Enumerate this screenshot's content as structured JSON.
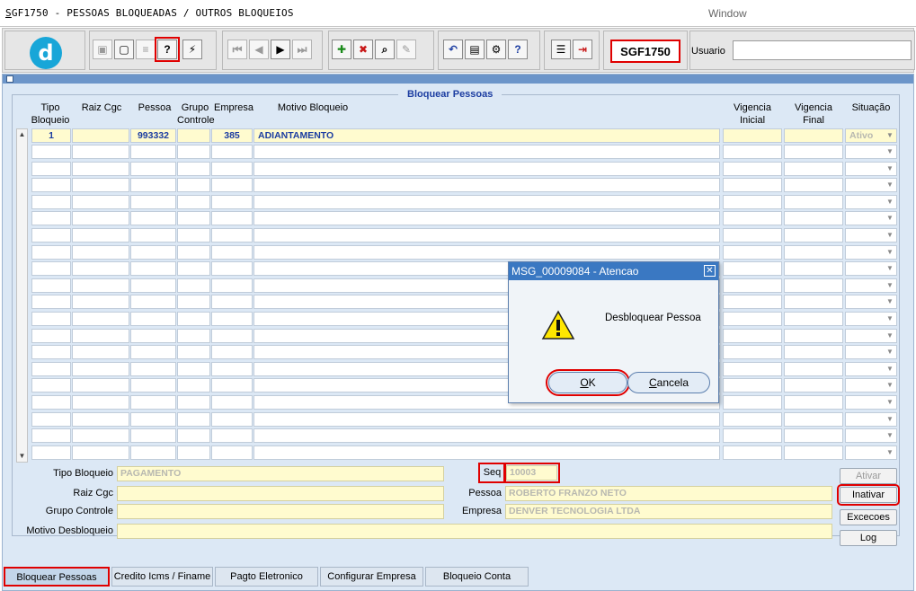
{
  "window": {
    "title_prefix": "S",
    "title_rest": "GF1750 - PESSOAS BLOQUEADAS / OUTROS BLOQUEIOS",
    "menu_window": "Window"
  },
  "toolbar": {
    "logo_letter": "d",
    "form_code": "SGF1750",
    "user_label": "Usuario",
    "user_value": "",
    "buttons": [
      {
        "icon": "save-icon",
        "glyph": "▣",
        "disabled": true
      },
      {
        "icon": "print-preview-icon",
        "glyph": "▢",
        "disabled": false
      },
      {
        "icon": "print-icon",
        "glyph": "≡",
        "disabled": true
      },
      {
        "icon": "query-help-icon",
        "glyph": "?",
        "disabled": false,
        "highlighted": true
      },
      {
        "icon": "execute-query-icon",
        "glyph": "⚡",
        "disabled": false
      },
      {
        "icon": "first-record-icon",
        "glyph": "⏮",
        "disabled": true
      },
      {
        "icon": "previous-record-icon",
        "glyph": "◀",
        "disabled": true
      },
      {
        "icon": "next-record-icon",
        "glyph": "▶",
        "disabled": false
      },
      {
        "icon": "last-record-icon",
        "glyph": "⏭",
        "disabled": true
      },
      {
        "icon": "insert-record-icon",
        "glyph": "✚",
        "disabled": false,
        "color": "#1a8a1a"
      },
      {
        "icon": "delete-record-icon",
        "glyph": "✖",
        "disabled": false,
        "color": "#c81818"
      },
      {
        "icon": "search-record-icon",
        "glyph": "⌕",
        "disabled": false
      },
      {
        "icon": "edit-record-icon",
        "glyph": "✎",
        "disabled": true
      },
      {
        "icon": "undo-icon",
        "glyph": "↶",
        "disabled": false,
        "color": "#1c3da1"
      },
      {
        "icon": "clipboard-icon",
        "glyph": "▤",
        "disabled": false
      },
      {
        "icon": "tools-icon",
        "glyph": "⚙",
        "disabled": false
      },
      {
        "icon": "help-icon",
        "glyph": "?",
        "disabled": false,
        "color": "#1c3da1"
      },
      {
        "icon": "menu-icon",
        "glyph": "☰",
        "disabled": false
      },
      {
        "icon": "exit-icon",
        "glyph": "⇥",
        "disabled": false,
        "color": "#c81818"
      }
    ]
  },
  "section": {
    "title": "Bloquear Pessoas"
  },
  "grid": {
    "headers": {
      "tipo_bloqueio": [
        "Tipo",
        "Bloqueio"
      ],
      "raiz_cgc": [
        "",
        "Raiz Cgc"
      ],
      "pessoa": [
        "",
        "Pessoa"
      ],
      "grupo_controle": [
        "Grupo",
        "Controle"
      ],
      "empresa": [
        "",
        "Empresa"
      ],
      "motivo_bloqueio": [
        "",
        "Motivo Bloqueio"
      ],
      "vigencia_inicial": [
        "Vigencia",
        "Inicial"
      ],
      "vigencia_final": [
        "Vigencia",
        "Final"
      ],
      "situacao": [
        "",
        "Situação"
      ]
    },
    "first_row": {
      "tipo_bloqueio": "1",
      "raiz_cgc": "",
      "pessoa": "993332",
      "grupo_controle": "",
      "empresa": "385",
      "motivo_bloqueio": "ADIANTAMENTO",
      "vigencia_inicial": "",
      "vigencia_final": "",
      "situacao": "Ativo"
    },
    "empty_rows": 19
  },
  "details": {
    "tipo_bloqueio_label": "Tipo Bloqueio",
    "tipo_bloqueio_value": "PAGAMENTO",
    "raiz_cgc_label": "Raiz Cgc",
    "raiz_cgc_value": "",
    "grupo_controle_label": "Grupo Controle",
    "grupo_controle_value": "",
    "motivo_desbloqueio_label": "Motivo Desbloqueio",
    "motivo_desbloqueio_value": "",
    "seq_label": "Seq",
    "seq_value": "10003",
    "pessoa_label": "Pessoa",
    "pessoa_value": "ROBERTO FRANZO NETO",
    "empresa_label": "Empresa",
    "empresa_value": "DENVER TECNOLOGIA LTDA"
  },
  "side_buttons": {
    "ativar": "Ativar",
    "inativar": "Inativar",
    "excecoes": "Excecoes",
    "log": "Log"
  },
  "tabs": [
    {
      "label": "Bloquear Pessoas",
      "active": true
    },
    {
      "label": "Credito Icms / Finame",
      "active": false
    },
    {
      "label": "Pagto Eletronico",
      "active": false
    },
    {
      "label": "Configurar Empresa",
      "active": false
    },
    {
      "label": "Bloqueio Conta",
      "active": false
    }
  ],
  "dialog": {
    "title": "MSG_00009084 - Atencao",
    "message": "Desbloquear Pessoa",
    "ok_underline": "O",
    "ok_rest": "K",
    "cancel_underline": "C",
    "cancel_rest": "ancela"
  },
  "colors": {
    "highlight": "#e00000",
    "header_blue": "#3a78c2",
    "field_yellow": "#fffbcf",
    "text_blue": "#1c3da1"
  }
}
